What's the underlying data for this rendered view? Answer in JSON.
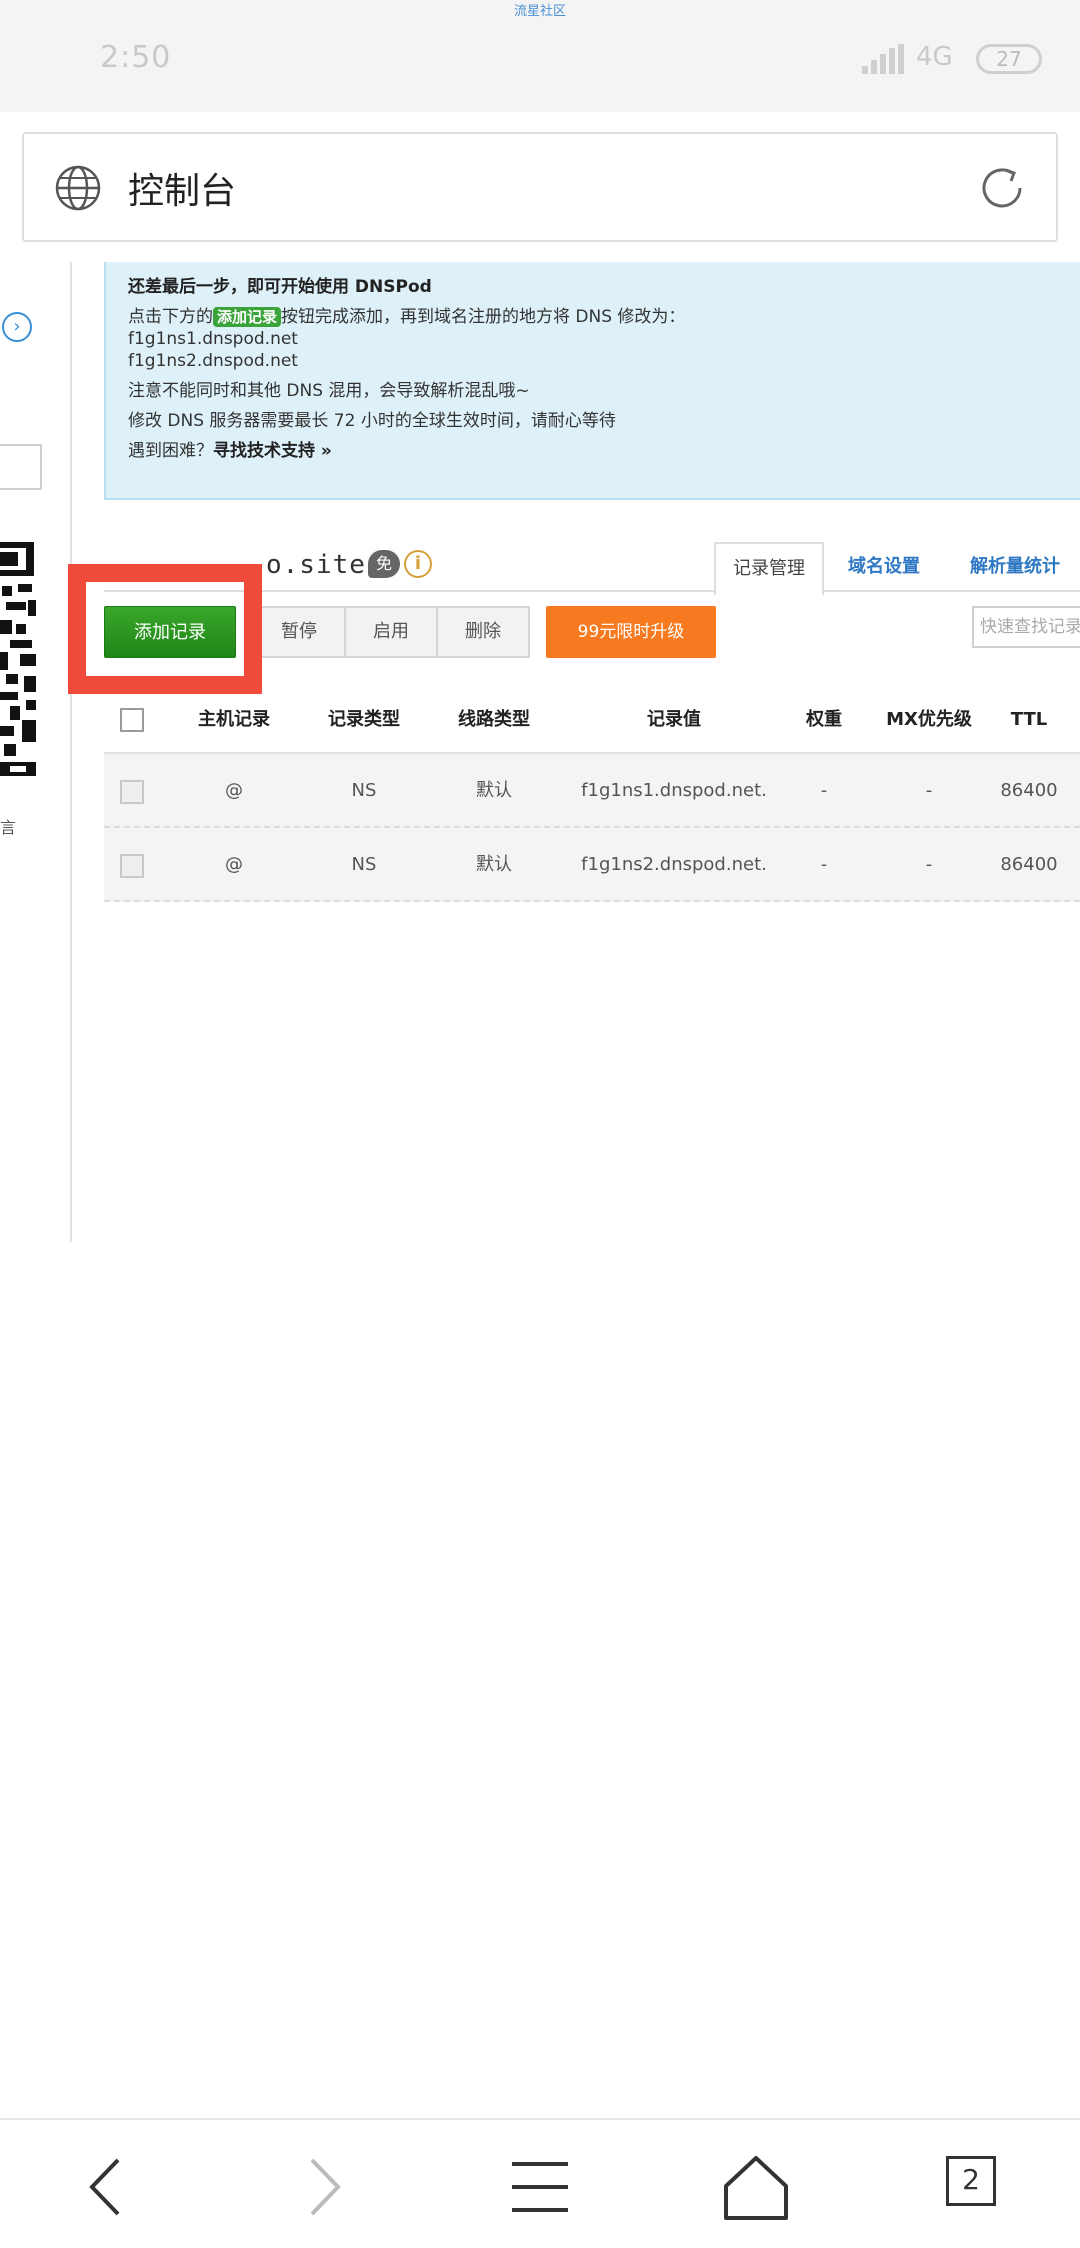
{
  "top_watermark": "流星社区",
  "status_bar": {
    "time": "2:50",
    "network": "4G",
    "battery": "27"
  },
  "url_bar": {
    "title": "控制台",
    "globe_icon": "globe-icon",
    "reload_icon": "reload-icon"
  },
  "sidebar": {
    "partial_text": "言"
  },
  "notice": {
    "heading": "还差最后一步，即可开始使用 DNSPod",
    "line1_before": "点击下方的",
    "line1_tag": "添加记录",
    "line1_after": "按钮完成添加，再到域名注册的地方将 DNS 修改为：",
    "ns1": "f1g1ns1.dnspod.net",
    "ns2": "f1g1ns2.dnspod.net",
    "warning": "注意不能同时和其他 DNS 混用，会导致解析混乱哦~",
    "ttl_note": "修改 DNS 服务器需要最长 72 小时的全球生效时间，请耐心等待",
    "help_prefix": "遇到困难？",
    "help_link": "寻找技术支持 »"
  },
  "domain": {
    "name": "o.site",
    "free_badge": "免",
    "info_icon": "i"
  },
  "tabs": [
    {
      "label": "记录管理",
      "active": true
    },
    {
      "label": "域名设置",
      "active": false
    },
    {
      "label": "解析量统计",
      "active": false
    }
  ],
  "toolbar": {
    "add_label": "添加记录",
    "pause_label": "暂停",
    "enable_label": "启用",
    "delete_label": "删除",
    "upgrade_label": "99元限时升级",
    "search_placeholder": "快速查找记录"
  },
  "table": {
    "headers": [
      "主机记录",
      "记录类型",
      "线路类型",
      "记录值",
      "权重",
      "MX优先级",
      "TTL"
    ],
    "rows": [
      [
        "@",
        "NS",
        "默认",
        "f1g1ns1.dnspod.net.",
        "-",
        "-",
        "86400"
      ],
      [
        "@",
        "NS",
        "默认",
        "f1g1ns2.dnspod.net.",
        "-",
        "-",
        "86400"
      ]
    ]
  },
  "bottom_nav": {
    "tab_count": "2"
  },
  "colors": {
    "add_button": "#2a9a22",
    "upgrade_button": "#f77a20",
    "highlight_box": "#f04a3c",
    "notice_bg": "#def1f8",
    "link": "#2f78c4"
  }
}
